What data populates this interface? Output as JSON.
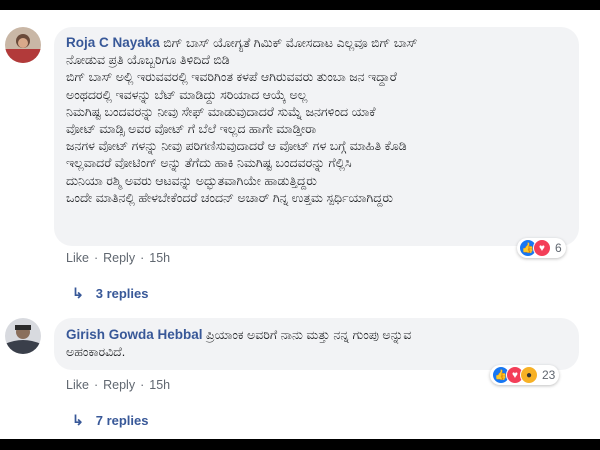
{
  "comments": [
    {
      "author": "Roja C Nayaka",
      "first_line": "ಬಿಗ್ ಬಾಸ್ ಯೋಗ್ಯತೆ ಗಿಮಿಕ್ ಮೋಸದಾಟ ಎಲ್ಲವೂ ಬಿಗ್ ಬಾಸ್",
      "lines": [
        "ನೋಡುವ ಪ್ರತಿ ಯೊಬ್ಬರಿಗೂ ತಿಳಿದಿದೆ ಬಿಡಿ",
        "ಬಿಗ್ ಬಾಸ್ ಅಲ್ಲಿ ಇರುವವರಲ್ಲಿ ಇವರಿಗಿಂತ ಕಳಪೆ ಆಗಿರುವವರು ತುಂಬಾ ಜನ ಇದ್ದಾರೆ",
        "ಅಂಥದರಲ್ಲಿ ಇವಳನ್ನು ಬೆಟ್ ಮಾಡಿದ್ದು ಸರಿಯಾದ ಆಯ್ಕೆ ಅಲ್ಲ",
        "ನಿಮಗಿಷ್ಟ ಬಂದವರನ್ನು ನೀವು ಸೇಫ್ ಮಾಡುವುದಾದರೆ ಸುಮ್ನೆ ಜನಗಳಿಂದ ಯಾಕೆ",
        "ವೋಟ್ ಮಾಡ್ಸಿ ಅವರ ವೋಟ್ ಗೆ ಬೆಲೆ ಇಲ್ಲದ ಹಾಗೇ ಮಾಡ್ತೀರಾ",
        "ಜನಗಳ ವೋಟ್ ಗಳನ್ನು ನೀವು ಪರಿಗಣಿಸುವುದಾದರೆ ಆ ವೋಟ್ ಗಳ ಬಗ್ಗೆ ಮಾಹಿತಿ ಕೊಡಿ",
        "ಇಲ್ಲವಾದರೆ ವೋಟಿಂಗ್ ಅನ್ನು ತೆಗೆದು ಹಾಕಿ ನಿಮಗಿಷ್ಟ ಬಂದವರನ್ನು ಗೆಲ್ಲಿಸಿ",
        "ದುನಿಯಾ ರಶ್ಮಿ ಅವರು ಆಟವನ್ನು ಅದ್ಭುತವಾಗಿಯೇ ಹಾಡುತ್ತಿದ್ದರು",
        "ಒಂದೇ ಮಾತಿನಲ್ಲಿ ಹೇಳಬೇಕೆಂದರೆ ಚಂದನ್ ಅಚಾರ್ ಗಿನ್ನ ಉತ್ತಮ ಸ್ಪರ್ಧಿಯಾಗಿದ್ದರು"
      ],
      "reaction_count": "6",
      "like": "Like",
      "reply": "Reply",
      "time": "15h",
      "replies": "3 replies"
    },
    {
      "author": "Girish Gowda Hebbal",
      "first_line": "ಪ್ರಿಯಾಂಕ ಅವರಿಗೆ ನಾನು ಮತ್ತು ನನ್ನ ಗುಂಪು ಅನ್ನುವ",
      "lines": [
        "ಅಹಂಕಾರವಿದೆ."
      ],
      "reaction_count": "23",
      "like": "Like",
      "reply": "Reply",
      "time": "15h",
      "replies": "7 replies"
    }
  ],
  "colors": {
    "author": "#385898",
    "bubble": "#f2f3f5",
    "like": "#1877f2",
    "love": "#f33e58",
    "wow": "#f7b125"
  },
  "icons": [
    "like-reaction-icon",
    "love-reaction-icon",
    "wow-reaction-icon",
    "reply-arrow-icon"
  ]
}
